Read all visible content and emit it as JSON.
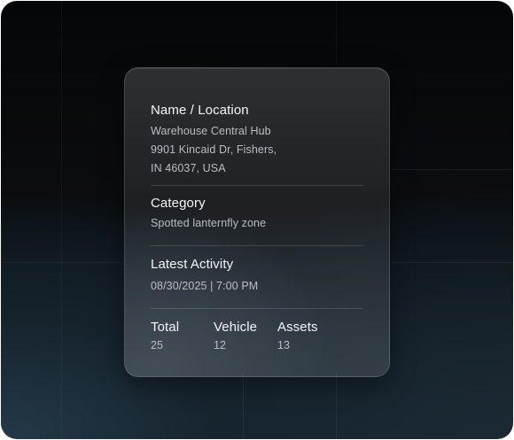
{
  "card": {
    "name_location": {
      "label": "Name / Location",
      "line1": "Warehouse Central Hub",
      "line2": "9901 Kincaid Dr, Fishers,",
      "line3": "IN 46037, USA"
    },
    "category": {
      "label": "Category",
      "value": "Spotted lanternfly zone"
    },
    "latest_activity": {
      "label": "Latest Activity",
      "value": "08/30/2025 | 7:00 PM"
    },
    "stats": {
      "total": {
        "label": "Total",
        "value": "25"
      },
      "vehicle": {
        "label": "Vehicle",
        "value": "12"
      },
      "assets": {
        "label": "Assets",
        "value": "13"
      }
    }
  },
  "colors": {
    "background_dark": "#050607",
    "background_teal": "#162632",
    "label_text": "#f4f5f6",
    "value_text": "#b9bec4"
  }
}
